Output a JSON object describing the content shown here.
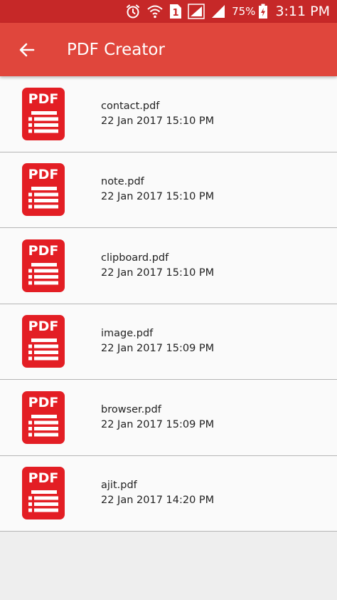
{
  "status_bar": {
    "battery_percent": "75%",
    "time": "3:11 PM",
    "sim_slot": "1",
    "icons": [
      "alarm-icon",
      "wifi-icon",
      "sim-1-icon",
      "signal-icon",
      "signal-icon",
      "battery-charging-icon"
    ]
  },
  "app_bar": {
    "title": "PDF Creator",
    "back_icon": "arrow-left-icon"
  },
  "colors": {
    "status_bar": "#c62828",
    "app_bar": "#e0463c",
    "pdf_icon": "#e31e24",
    "list_bg": "#fafafa",
    "page_bg": "#eeeeee"
  },
  "pdf_icon_label": "PDF",
  "files": [
    {
      "name": "contact.pdf",
      "date": "22 Jan 2017 15:10 PM"
    },
    {
      "name": "note.pdf",
      "date": "22 Jan 2017 15:10 PM"
    },
    {
      "name": "clipboard.pdf",
      "date": "22 Jan 2017 15:10 PM"
    },
    {
      "name": "image.pdf",
      "date": "22 Jan 2017 15:09 PM"
    },
    {
      "name": "browser.pdf",
      "date": "22 Jan 2017 15:09 PM"
    },
    {
      "name": "ajit.pdf",
      "date": "22 Jan 2017 14:20 PM"
    }
  ]
}
